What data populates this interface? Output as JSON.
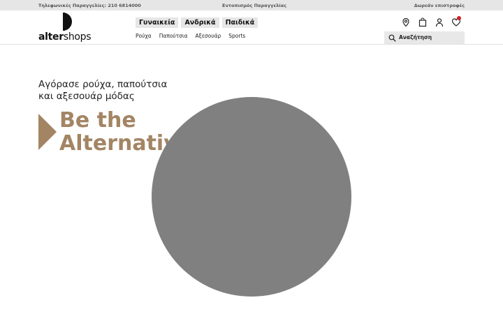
{
  "topbar": {
    "phone": "Τηλεφωνικές Παραγγελίες: 210 6814000",
    "tracking": "Εντοπισμός Παραγγελίας",
    "returns": "Δωρεάν επιστροφές"
  },
  "logo": {
    "word_bold": "alter",
    "word_regular": "shops"
  },
  "gender_tabs": [
    "Γυναικεία",
    "Ανδρικά",
    "Παιδικά"
  ],
  "subnav": [
    "Ρούχα",
    "Παπούτσια",
    "Αξεσουάρ",
    "Sports"
  ],
  "icons": [
    "location-pin-icon",
    "shopping-bag-icon",
    "user-icon",
    "heart-icon"
  ],
  "search": {
    "label": "Αναζήτηση"
  },
  "hero": {
    "subtitle_line1": "Αγόρασε ρούχα, παπούτσια",
    "subtitle_line2": "και αξεσουάρ μόδας",
    "title_line1": "Be the",
    "title_line2": "Alternative You!",
    "accent_color": "#a38564"
  },
  "overlay": {
    "circle_color": "#808080"
  }
}
